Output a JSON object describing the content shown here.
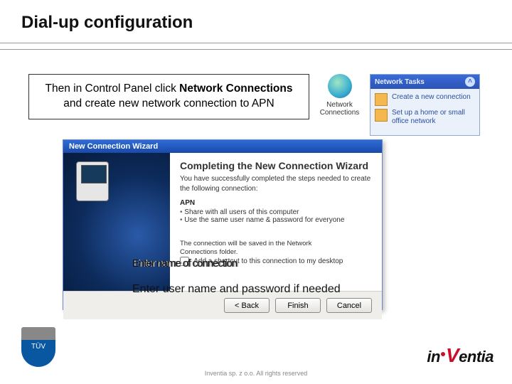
{
  "header": {
    "title": "Dial-up configuration"
  },
  "instruction": {
    "prefix": "Then in Control Panel click ",
    "bold": "Network Connections",
    "line2": "and create new network connection to APN"
  },
  "nc_icon": {
    "label": "Network Connections"
  },
  "tasks_pane": {
    "header": "Network Tasks",
    "items": [
      "Create a new connection",
      "Set up a home or small office network"
    ]
  },
  "wizard": {
    "title": "New Connection Wizard",
    "heading": "Completing the New Connection Wizard",
    "body": "You have successfully completed the steps needed to create the following connection:",
    "apn_title": "APN",
    "bullets": [
      "Share with all users of this computer",
      "Use the same user name & password for everyone"
    ],
    "saved1": "The connection will be saved in the Network",
    "saved2": "Connections folder.",
    "shortcut_label": "Add a shortcut to this connection to my desktop",
    "buttons": {
      "back": "< Back",
      "finish": "Finish",
      "cancel": "Cancel"
    }
  },
  "overlay": {
    "line1": "Enter name of connection",
    "line2": "Enter user name and password if needed"
  },
  "copyright": "Inventia sp. z o.o. All rights reserved",
  "logo": {
    "pre": "in",
    "v": "V",
    "post": "entia"
  },
  "badge": {
    "top": "",
    "bot": "TÜV"
  }
}
